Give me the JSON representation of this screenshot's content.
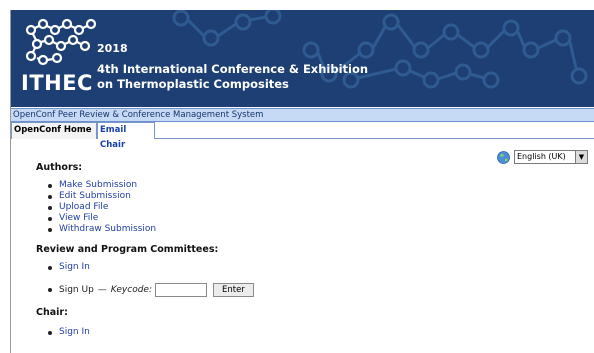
{
  "banner": {
    "logo_text": "ITHEC",
    "year": "2018",
    "title_line1": "4th International Conference & Exhibition",
    "title_line2": "on Thermoplastic Composites"
  },
  "system_bar": {
    "text": "OpenConf Peer Review & Conference Management System"
  },
  "tabs": [
    {
      "label": "OpenConf Home"
    },
    {
      "label": "Email Chair"
    }
  ],
  "language": {
    "selected": "English (UK)",
    "icon": "globe-icon"
  },
  "authors": {
    "title": "Authors:",
    "items": [
      {
        "label": "Make Submission"
      },
      {
        "label": "Edit Submission"
      },
      {
        "label": "Upload File"
      },
      {
        "label": "View File"
      },
      {
        "label": "Withdraw Submission"
      }
    ]
  },
  "committees": {
    "title": "Review and Program Committees:",
    "sign_in": "Sign In",
    "sign_up": "Sign Up",
    "dash": "—",
    "keycode_label": "Keycode:",
    "enter_label": "Enter"
  },
  "chair": {
    "title": "Chair:",
    "sign_in": "Sign In"
  },
  "colors": {
    "banner_bg": "#1d3f73",
    "system_bar_bg": "#c6d9f5",
    "link": "#1f3fa6"
  }
}
